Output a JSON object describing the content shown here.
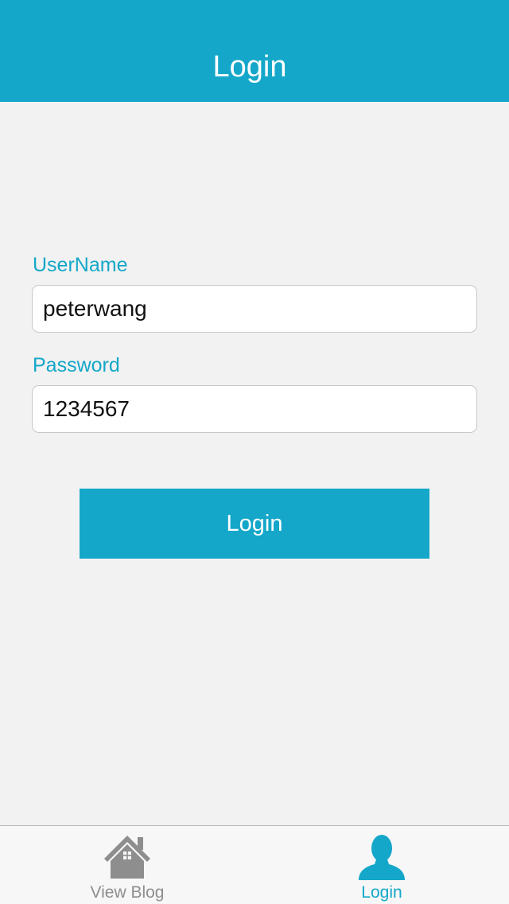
{
  "nav": {
    "title": "Login"
  },
  "form": {
    "username_label": "UserName",
    "username_value": "peterwang",
    "password_label": "Password",
    "password_value": "1234567",
    "submit_label": "Login"
  },
  "tabs": [
    {
      "label": "View Blog",
      "icon": "house-icon",
      "active": false
    },
    {
      "label": "Login",
      "icon": "person-icon",
      "active": true
    }
  ],
  "colors": {
    "accent": "#14a7c9",
    "background": "#f2f2f2",
    "tab_inactive": "#8e8e8e",
    "tab_active": "#14a7c9"
  }
}
